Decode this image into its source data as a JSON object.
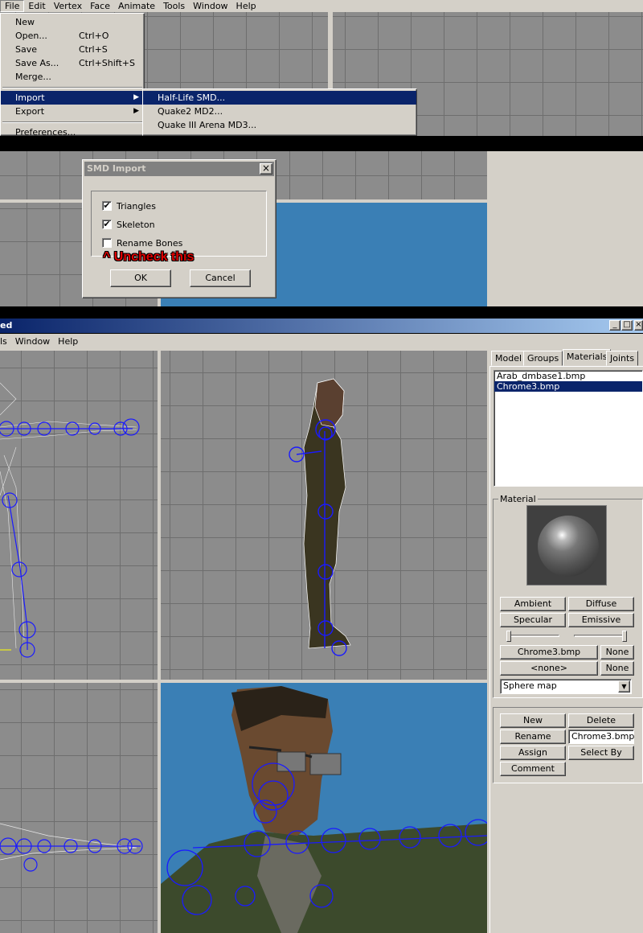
{
  "menubar_top": [
    "File",
    "Edit",
    "Vertex",
    "Face",
    "Animate",
    "Tools",
    "Window",
    "Help"
  ],
  "file_menu": {
    "items": [
      {
        "label": "New",
        "shortcut": ""
      },
      {
        "label": "Open...",
        "shortcut": "Ctrl+O"
      },
      {
        "label": "Save",
        "shortcut": "Ctrl+S"
      },
      {
        "label": "Save As...",
        "shortcut": "Ctrl+Shift+S"
      },
      {
        "label": "Merge...",
        "shortcut": ""
      }
    ],
    "import_label": "Import",
    "export_label": "Export",
    "preferences_label": "Preferences..."
  },
  "import_submenu": [
    "Half-Life SMD...",
    "Quake2 MD2...",
    "Quake III Arena MD3..."
  ],
  "smd_dialog": {
    "title": "SMD Import",
    "close": "×",
    "triangles": {
      "label": "Triangles",
      "checked": "✔"
    },
    "skeleton": {
      "label": "Skeleton",
      "checked": "✔"
    },
    "rename_bones": {
      "label": "Rename Bones"
    },
    "ok": "OK",
    "cancel": "Cancel"
  },
  "annotation": "^ Uncheck this",
  "window": {
    "title_fragment": "ed",
    "controls": [
      "_",
      "□",
      "×"
    ],
    "menubar": [
      "ls",
      "Window",
      "Help"
    ]
  },
  "tabs": [
    "Model",
    "Groups",
    "Materials",
    "Joints"
  ],
  "materials_list": [
    "Arab_dmbase1.bmp",
    "Chrome3.bmp"
  ],
  "material_panel": {
    "label": "Material",
    "ambient": "Ambient",
    "diffuse": "Diffuse",
    "specular": "Specular",
    "emissive": "Emissive",
    "texture": "Chrome3.bmp",
    "texture_none": "None",
    "alpha": "<none>",
    "alpha_none": "None",
    "mapping": "Sphere map",
    "dropdown_arrow": "▼"
  },
  "actions": {
    "new": "New",
    "delete": "Delete",
    "rename": "Rename",
    "rename_value": "Chrome3.bmp",
    "assign": "Assign",
    "select_by": "Select By",
    "comment": "Comment"
  },
  "colors": {
    "menu_bg": "#d4d0c8",
    "highlight": "#0a246a",
    "viewport_grid": "#8c8c8c",
    "viewport_3d": "#3a7fb5",
    "bones": "#1a1aff",
    "annotation": "#e00000"
  }
}
